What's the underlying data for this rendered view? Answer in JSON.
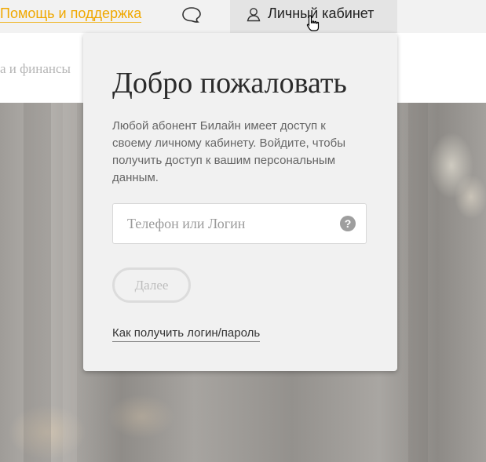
{
  "header": {
    "help_link": "Помощь и поддержка",
    "chat_icon": "chat-bubble-icon",
    "account_label": "Личный кабинет",
    "account_icon": "user-icon"
  },
  "subnav": {
    "partial_item": "а и финансы"
  },
  "popup": {
    "title": "Добро пожаловать",
    "description": "Любой абонент Билайн имеет доступ к своему личному кабинету. Войдите, чтобы получить доступ к вашим персональным данным.",
    "login_field": {
      "placeholder": "Телефон или Логин",
      "value": "",
      "help_icon_glyph": "?"
    },
    "next_button": "Далее",
    "how_link": "Как получить логин/пароль"
  },
  "colors": {
    "brand_accent": "#f0a800",
    "popup_bg": "#f1f1f1",
    "topbar_bg": "#f2f2f2"
  }
}
